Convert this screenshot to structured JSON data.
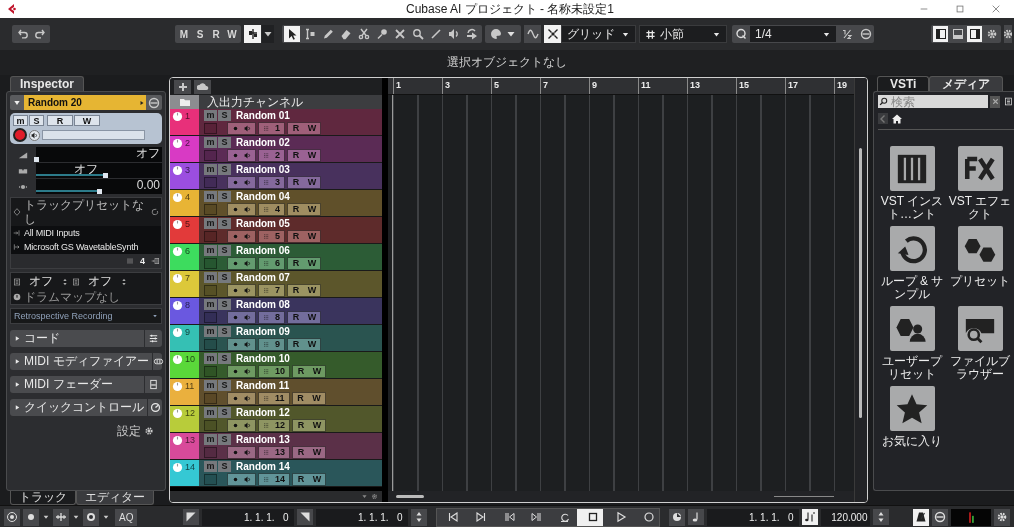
{
  "window": {
    "title": "Cubase AI プロジェクト - 名称未設定1"
  },
  "toolbar": {
    "automation_letters": [
      "M",
      "S",
      "R",
      "W"
    ],
    "automation_panel_on": true,
    "tools": [
      {
        "selected": true
      },
      {
        "selected": false
      },
      {
        "selected": false
      },
      {
        "selected": false
      },
      {
        "selected": false
      },
      {
        "selected": false
      },
      {
        "selected": false
      },
      {
        "selected": false
      },
      {
        "selected": false
      },
      {
        "selected": false
      },
      {
        "selected": false
      }
    ],
    "snap_on": true,
    "snap_type": "グリッド",
    "grid_type": "小節",
    "quantize": "1/4",
    "zones": [
      {
        "on": true
      },
      {
        "on": false
      },
      {
        "on": true
      }
    ]
  },
  "info_line": "選択オブジェクトなし",
  "inspector": {
    "tab": {
      "label": "Inspector",
      "selected": true
    },
    "track_name": "Random 20",
    "expanded": true,
    "buttons": [
      "m",
      "S",
      "R",
      "W"
    ],
    "record_armed": true,
    "faders": [
      {
        "value": "オフ",
        "level": 0
      },
      {
        "value": "オフ",
        "level": 0.55
      },
      {
        "value": "0.00",
        "level": 0.5
      }
    ],
    "preset": "トラックプリセットなし",
    "input": "All MIDI Inputs",
    "output": "Microsoft GS WavetableSynth",
    "channel": "4",
    "bank": "オフ",
    "program": "オフ",
    "drum_map": "ドラムマップなし",
    "retrospective": "Retrospective Recording",
    "sections": [
      {
        "label": "コード",
        "expanded": false
      },
      {
        "label": "MIDI モディファイアー",
        "expanded": false
      },
      {
        "label": "MIDI フェーダー",
        "expanded": false
      },
      {
        "label": "クイックコントロール",
        "expanded": false
      }
    ],
    "settings": "設定",
    "bottom_tabs": [
      {
        "label": "トラック",
        "selected": false
      },
      {
        "label": "エディター",
        "selected": true
      }
    ]
  },
  "track_list": {
    "folder": "入出力チャンネル",
    "tracks": [
      {
        "number": "1",
        "name": "Random 01",
        "color": "#e8307a",
        "channel": "1",
        "buttons": [
          "m",
          "S",
          "R",
          "W"
        ]
      },
      {
        "number": "2",
        "name": "Random 02",
        "color": "#d83ac4",
        "channel": "2",
        "buttons": [
          "m",
          "S",
          "R",
          "W"
        ]
      },
      {
        "number": "3",
        "name": "Random 03",
        "color": "#9b4ee0",
        "channel": "3",
        "buttons": [
          "m",
          "S",
          "R",
          "W"
        ]
      },
      {
        "number": "4",
        "name": "Random 04",
        "color": "#e8b435",
        "channel": "4",
        "buttons": [
          "m",
          "S",
          "R",
          "W"
        ]
      },
      {
        "number": "5",
        "name": "Random 05",
        "color": "#e23a3a",
        "channel": "5",
        "buttons": [
          "m",
          "S",
          "R",
          "W"
        ]
      },
      {
        "number": "6",
        "name": "Random 06",
        "color": "#3ddc5e",
        "channel": "6",
        "buttons": [
          "m",
          "S",
          "R",
          "W"
        ]
      },
      {
        "number": "7",
        "name": "Random 07",
        "color": "#dcc83a",
        "channel": "7",
        "buttons": [
          "m",
          "S",
          "R",
          "W"
        ]
      },
      {
        "number": "8",
        "name": "Random 08",
        "color": "#6a58e0",
        "channel": "8",
        "buttons": [
          "m",
          "S",
          "R",
          "W"
        ]
      },
      {
        "number": "9",
        "name": "Random 09",
        "color": "#35c0b4",
        "channel": "9",
        "buttons": [
          "m",
          "S",
          "R",
          "W"
        ]
      },
      {
        "number": "10",
        "name": "Random 10",
        "color": "#5ad83a",
        "channel": "10",
        "buttons": [
          "m",
          "S",
          "R",
          "W"
        ]
      },
      {
        "number": "11",
        "name": "Random 11",
        "color": "#eab03e",
        "channel": "11",
        "buttons": [
          "m",
          "S",
          "R",
          "W"
        ]
      },
      {
        "number": "12",
        "name": "Random 12",
        "color": "#b8cc3a",
        "channel": "12",
        "buttons": [
          "m",
          "S",
          "R",
          "W"
        ]
      },
      {
        "number": "13",
        "name": "Random 13",
        "color": "#d84a9a",
        "channel": "13",
        "buttons": [
          "m",
          "S",
          "R",
          "W"
        ]
      },
      {
        "number": "14",
        "name": "Random 14",
        "color": "#35c8d4",
        "channel": "14",
        "buttons": [
          "m",
          "S",
          "R",
          "W"
        ]
      }
    ]
  },
  "ruler": [
    "1",
    "3",
    "5",
    "7",
    "9",
    "11",
    "13",
    "15",
    "17",
    "19"
  ],
  "right_zone": {
    "tabs": [
      {
        "label": "VSTi",
        "selected": false
      },
      {
        "label": "メディア",
        "selected": true
      }
    ],
    "search_placeholder": "検索",
    "tiles": [
      {
        "label": "VST インスト…ント"
      },
      {
        "label": "VST エフェクト"
      },
      {
        "label": "ループ & サンプル"
      },
      {
        "label": "プリセット"
      },
      {
        "label": "ユーザープリセット"
      },
      {
        "label": "ファイルブラウザー"
      },
      {
        "label": "お気に入り"
      }
    ]
  },
  "transport": {
    "aq": "AQ",
    "left_locator": "1. 1. 1.   0",
    "right_locator": "1. 1. 1.   0",
    "stop_selected": true,
    "position": "1. 1. 1.   0",
    "tempo": "120.000"
  }
}
